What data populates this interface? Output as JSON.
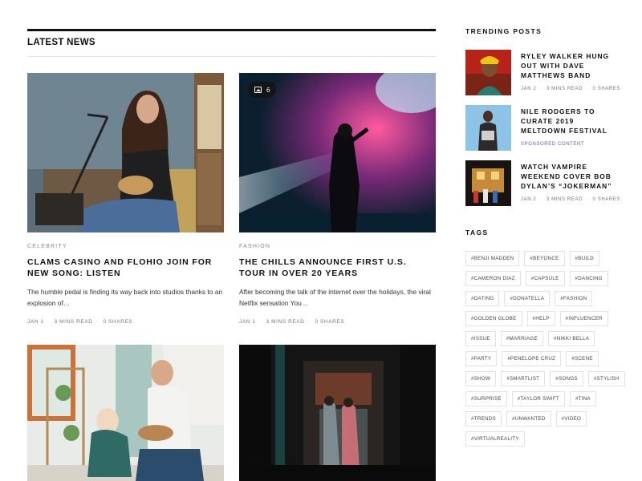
{
  "latest": {
    "title": "LATEST NEWS",
    "articles": [
      {
        "category": "CELEBRITY",
        "title": "CLAMS CASINO AND FLOHIO JOIN FOR NEW SONG: LISTEN",
        "excerpt": "The humble pedal is finding its way back into studios thanks to an explosion of…",
        "date": "JAN 1",
        "read": "3 MINS READ",
        "shares": "0 SHARES"
      },
      {
        "category": "FASHION",
        "title": "THE CHILLS ANNOUNCE FIRST U.S. TOUR IN OVER 20 YEARS",
        "excerpt": "After becoming the talk of the internet over the holidays, the viral Netflix sensation You…",
        "date": "JAN 1",
        "read": "3 MINS READ",
        "shares": "0 SHARES",
        "gallery_count": "6"
      },
      {
        "category": "",
        "title": ""
      },
      {
        "category": "",
        "title": ""
      }
    ]
  },
  "trending": {
    "title": "TRENDING POSTS",
    "posts": [
      {
        "title": "RYLEY WALKER HUNG OUT WITH DAVE MATTHEWS BAND",
        "date": "JAN 2",
        "read": "3 MINS READ",
        "shares": "0 SHARES"
      },
      {
        "title": "NILE RODGERS TO CURATE 2019 MELTDOWN FESTIVAL",
        "sponsored": "SPONSORED CONTENT"
      },
      {
        "title": "WATCH VAMPIRE WEEKEND COVER BOB DYLAN’S “JOKERMAN”",
        "date": "JAN 2",
        "read": "3 MINS READ",
        "shares": "0 SHARES"
      }
    ]
  },
  "tags": {
    "title": "TAGS",
    "items": [
      "#BENJI MADDEN",
      "#BEYONCE",
      "#BUILD",
      "#CAMERON DIAZ",
      "#CAPSULE",
      "#DANCING",
      "#DATING",
      "#DONATELLA",
      "#FASHION",
      "#GOLDEN GLOBE",
      "#HELP",
      "#INFLUENCER",
      "#ISSUE",
      "#MARRIAGE",
      "#NIKKI BELLA",
      "#PARTY",
      "#PENELOPE CRUZ",
      "#SCENE",
      "#SHOW",
      "#SMARTLIST",
      "#SONGS",
      "#STYLISH",
      "#SURPRISE",
      "#TAYLOR SWIFT",
      "#TINA",
      "#TRENDS",
      "#UNWANTED",
      "#VIDEO",
      "#VIRTUALREALITY"
    ]
  },
  "icons": {
    "gallery": "image-gallery-icon"
  },
  "colors": {
    "accent": "#111111",
    "sponsored": "#6a5acd",
    "meta": "#777777"
  }
}
